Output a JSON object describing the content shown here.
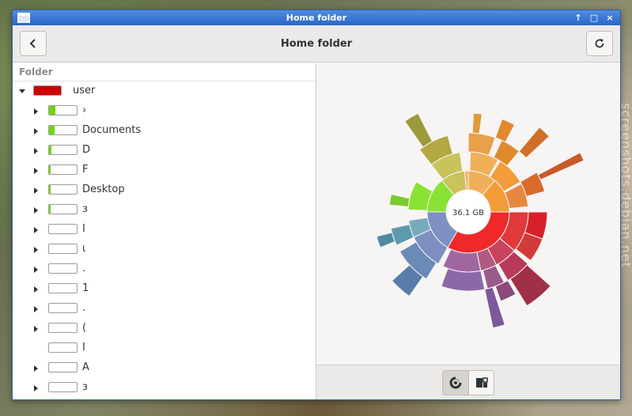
{
  "window": {
    "title": "Home folder",
    "wm_buttons": [
      "↑",
      "□",
      "×"
    ]
  },
  "header": {
    "title": "Home folder",
    "back_icon": "back-arrow-icon",
    "refresh_icon": "refresh-icon"
  },
  "tree": {
    "column_header": "Folder",
    "rows": [
      {
        "label": "user",
        "level": 0,
        "expander": "expanded",
        "fill": 1.0,
        "color": "#cc0000"
      },
      {
        "label": "›",
        "level": 1,
        "expander": "collapsed",
        "fill": 0.22,
        "color": "#73d216"
      },
      {
        "label": "Documents",
        "level": 1,
        "expander": "collapsed",
        "fill": 0.2,
        "color": "#73d216"
      },
      {
        "label": "D",
        "level": 1,
        "expander": "collapsed",
        "fill": 0.08,
        "color": "#73d216"
      },
      {
        "label": "F",
        "level": 1,
        "expander": "collapsed",
        "fill": 0.07,
        "color": "#73d216"
      },
      {
        "label": "Desktop",
        "level": 1,
        "expander": "collapsed",
        "fill": 0.05,
        "color": "#73d216"
      },
      {
        "label": "ɜ",
        "level": 1,
        "expander": "collapsed",
        "fill": 0.03,
        "color": "#73d216"
      },
      {
        "label": "I",
        "level": 1,
        "expander": "collapsed",
        "fill": 0.0,
        "color": "#73d216"
      },
      {
        "label": "ι",
        "level": 1,
        "expander": "collapsed",
        "fill": 0.0,
        "color": "#73d216"
      },
      {
        "label": ".",
        "level": 1,
        "expander": "collapsed",
        "fill": 0.0,
        "color": "#73d216"
      },
      {
        "label": "1",
        "level": 1,
        "expander": "collapsed",
        "fill": 0.0,
        "color": "#73d216"
      },
      {
        "label": ".",
        "level": 1,
        "expander": "collapsed",
        "fill": 0.0,
        "color": "#73d216"
      },
      {
        "label": "(",
        "level": 1,
        "expander": "collapsed",
        "fill": 0.0,
        "color": "#73d216"
      },
      {
        "label": "I",
        "level": 1,
        "expander": "none",
        "fill": 0.0,
        "color": "#73d216"
      },
      {
        "label": "A",
        "level": 1,
        "expander": "collapsed",
        "fill": 0.0,
        "color": "#73d216"
      },
      {
        "label": "ɜ",
        "level": 1,
        "expander": "collapsed",
        "fill": 0.0,
        "color": "#73d216"
      }
    ]
  },
  "chart": {
    "center_label": "36.1 GB",
    "view_buttons": [
      {
        "icon": "ring-chart-icon",
        "active": true
      },
      {
        "icon": "treemap-icon",
        "active": false
      }
    ]
  },
  "watermark": "screenshots.debian.net"
}
